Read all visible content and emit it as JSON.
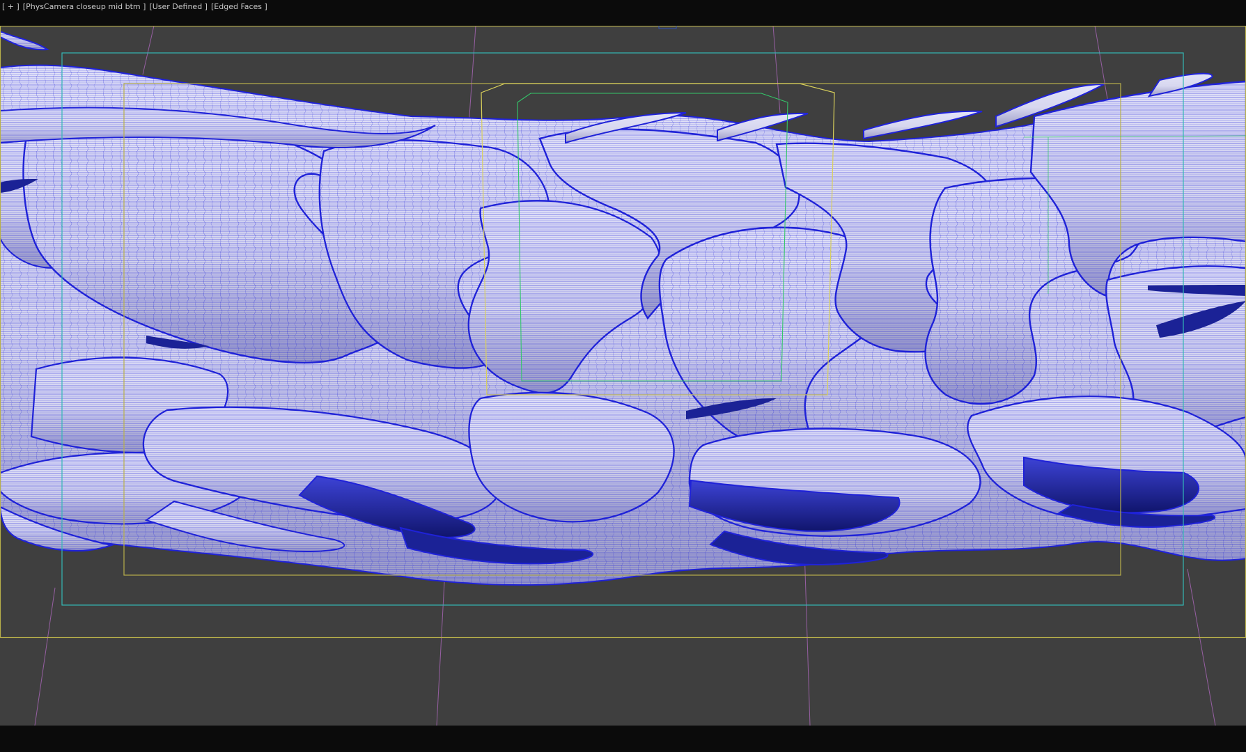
{
  "viewport": {
    "menu_label": "[ + ]",
    "camera_label": "[PhysCamera closeup mid btm ]",
    "shading_label": "[User Defined ]",
    "display_label": "[Edged Faces ]"
  },
  "colors": {
    "viewport_bg": "#3f3f3f",
    "frame_yellow": "#b8b04a",
    "safe_cyan": "#33b8b5",
    "camera_green": "#34c76a",
    "mesh_blue": "#1f22d8",
    "mesh_face": "#dcdcf5"
  },
  "icons": {
    "menu": "plus-icon"
  }
}
